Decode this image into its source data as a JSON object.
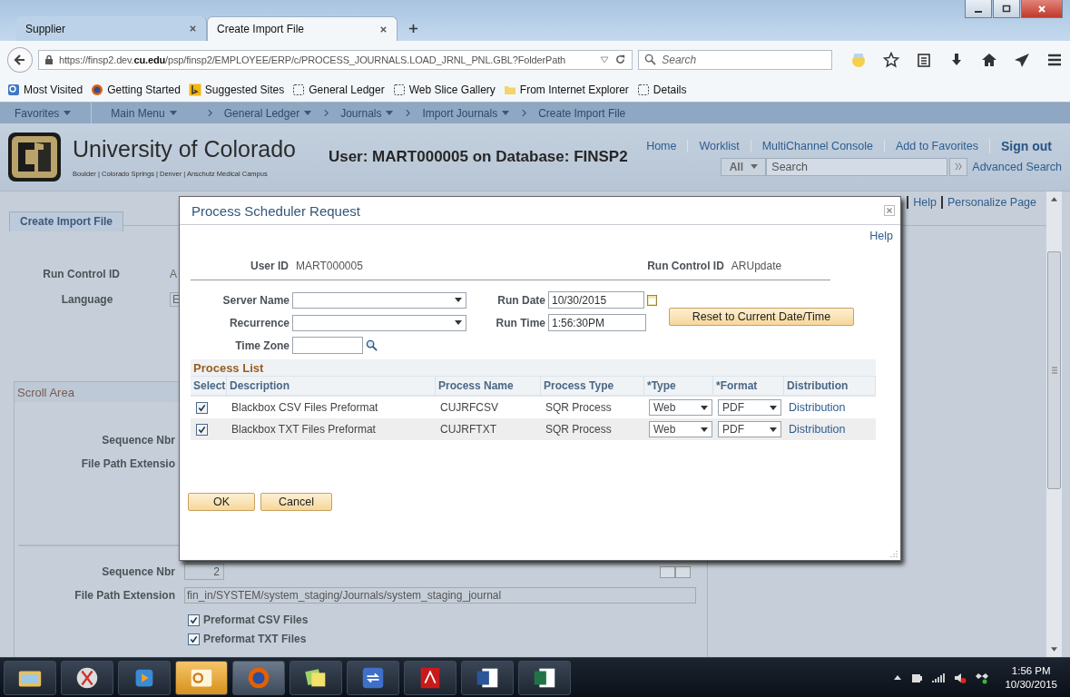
{
  "browser": {
    "tabs": [
      {
        "label": "Supplier",
        "selected": false
      },
      {
        "label": "Create Import File",
        "selected": true
      }
    ],
    "url": "https://finsp2.dev.**cu.edu**/psp/finsp2/EMPLOYEE/ERP/c/PROCESS_JOURNALS.LOAD_JRNL_PNL.GBL?FolderPath",
    "search_placeholder": "Search",
    "bookmarks": [
      {
        "label": "Most Visited",
        "kind": "page"
      },
      {
        "label": "Getting Started",
        "kind": "firefox"
      },
      {
        "label": "Suggested Sites",
        "kind": "bing"
      },
      {
        "label": "General Ledger",
        "kind": "slice"
      },
      {
        "label": "Web Slice Gallery",
        "kind": "slice"
      },
      {
        "label": "From Internet Explorer",
        "kind": "folder"
      },
      {
        "label": "Details",
        "kind": "slice"
      }
    ]
  },
  "nav": [
    {
      "label": "Favorites",
      "menu": true,
      "chevron": false
    },
    {
      "label": "Main Menu",
      "menu": true,
      "chevron": false
    },
    {
      "label": "General Ledger",
      "menu": true,
      "chevron": true
    },
    {
      "label": "Journals",
      "menu": true,
      "chevron": true
    },
    {
      "label": "Import Journals",
      "menu": true,
      "chevron": true
    },
    {
      "label": "Create Import File",
      "menu": false,
      "chevron": true
    }
  ],
  "header": {
    "org": "University of Colorado",
    "campuses": "Boulder | Colorado Springs | Denver | Anschutz Medical Campus",
    "user_line": "User: MART000005 on Database: FINSP2",
    "links": [
      "Home",
      "Worklist",
      "MultiChannel Console",
      "Add to Favorites"
    ],
    "sign_out": "Sign out",
    "search_scope": "All",
    "search_placeholder": "Search",
    "advanced_search": "Advanced Search"
  },
  "page": {
    "tab": "Create Import File",
    "top_links": [
      "Help",
      "Personalize Page"
    ],
    "run_control_label": "Run Control ID",
    "run_control_value": "A",
    "language_label": "Language",
    "language_value": "E",
    "scroll_area": {
      "title": "Scroll Area",
      "first": {
        "seq_label": "Sequence Nbr",
        "path_label": "File Path Extensio"
      },
      "second": {
        "seq_label": "Sequence Nbr",
        "seq_value": "2",
        "path_label": "File Path Extension",
        "path_value": "fin_in/SYSTEM/system_staging/Journals/system_staging_journal",
        "options": [
          {
            "label": "Preformat CSV Files",
            "checked": true
          },
          {
            "label": "Preformat TXT Files",
            "checked": true
          }
        ]
      }
    }
  },
  "dialog": {
    "title": "Process Scheduler Request",
    "help": "Help",
    "user_id_label": "User ID",
    "user_id": "MART000005",
    "run_control_label": "Run Control ID",
    "run_control": "ARUpdate",
    "server_name_label": "Server Name",
    "recurrence_label": "Recurrence",
    "time_zone_label": "Time Zone",
    "run_date_label": "Run Date",
    "run_date": "10/30/2015",
    "run_time_label": "Run Time",
    "run_time": "1:56:30PM",
    "reset": "Reset to Current Date/Time",
    "process_list": {
      "title": "Process List",
      "columns": [
        "Select",
        "Description",
        "Process Name",
        "Process Type",
        "*Type",
        "*Format",
        "Distribution"
      ],
      "rows": [
        {
          "checked": true,
          "description": "Blackbox CSV Files Preformat",
          "name": "CUJRFCSV",
          "type": "SQR Process",
          "out_type": "Web",
          "format": "PDF",
          "distribution": "Distribution"
        },
        {
          "checked": true,
          "description": "Blackbox TXT Files Preformat",
          "name": "CUJRFTXT",
          "type": "SQR Process",
          "out_type": "Web",
          "format": "PDF",
          "distribution": "Distribution"
        }
      ]
    },
    "buttons": [
      "OK",
      "Cancel"
    ]
  },
  "taskbar": {
    "time": "1:56 PM",
    "date": "10/30/2015"
  }
}
